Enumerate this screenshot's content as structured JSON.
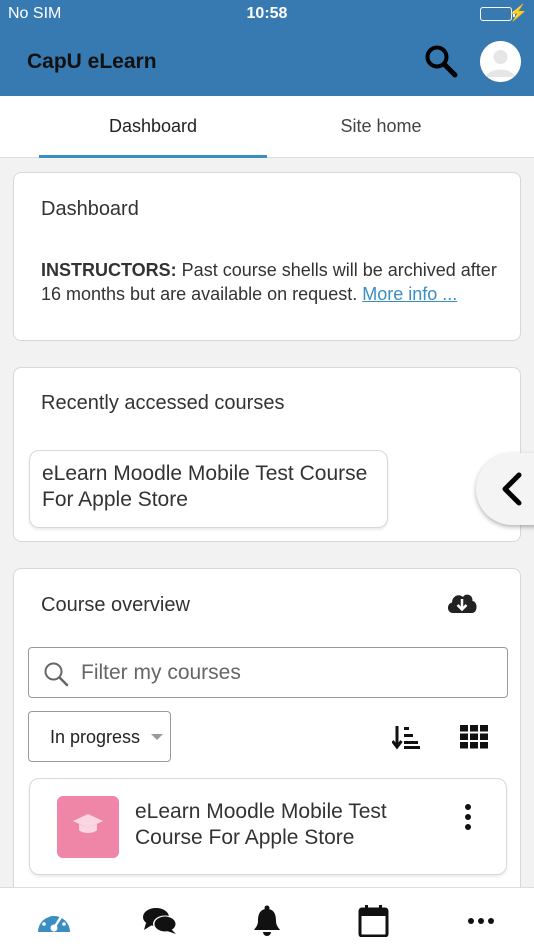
{
  "status_bar": {
    "carrier": "No SIM",
    "time": "10:58",
    "battery_level": 1.0,
    "battery_color": "#6cd96c"
  },
  "app_bar": {
    "title": "CapU eLearn",
    "search_icon": "search-icon",
    "avatar_icon": "user-avatar-icon",
    "background": "#3779b1"
  },
  "tabs": [
    {
      "label": "Dashboard",
      "active": true
    },
    {
      "label": "Site home",
      "active": false
    }
  ],
  "dashboard_block": {
    "title": "Dashboard",
    "notice_bold": "INSTRUCTORS:",
    "notice_text": " Past course shells will be archived after 16 months but are available on request. ",
    "link_text": "More info ..."
  },
  "recent_block": {
    "title": "Recently accessed courses",
    "course": "eLearn Moodle Mobile Test Course For Apple Store"
  },
  "overview_block": {
    "title": "Course overview",
    "download_icon": "cloud-download-icon",
    "filter_placeholder": "Filter my courses",
    "status_select": "In progress",
    "sort_icon": "sort-icon",
    "view_icon": "grid-view-icon",
    "course": {
      "name": "eLearn Moodle Mobile Test Course For Apple Store",
      "thumb_color": "#ef86a8",
      "thumb_icon": "graduation-cap-icon",
      "menu_icon": "kebab-menu-icon"
    }
  },
  "side_toggle_icon": "chevron-left-icon",
  "bottom_nav": [
    {
      "icon": "dashboard-gauge-icon"
    },
    {
      "icon": "messages-icon"
    },
    {
      "icon": "notifications-bell-icon"
    },
    {
      "icon": "calendar-icon"
    },
    {
      "icon": "more-icon"
    }
  ],
  "accent_color": "#3b8ec2"
}
